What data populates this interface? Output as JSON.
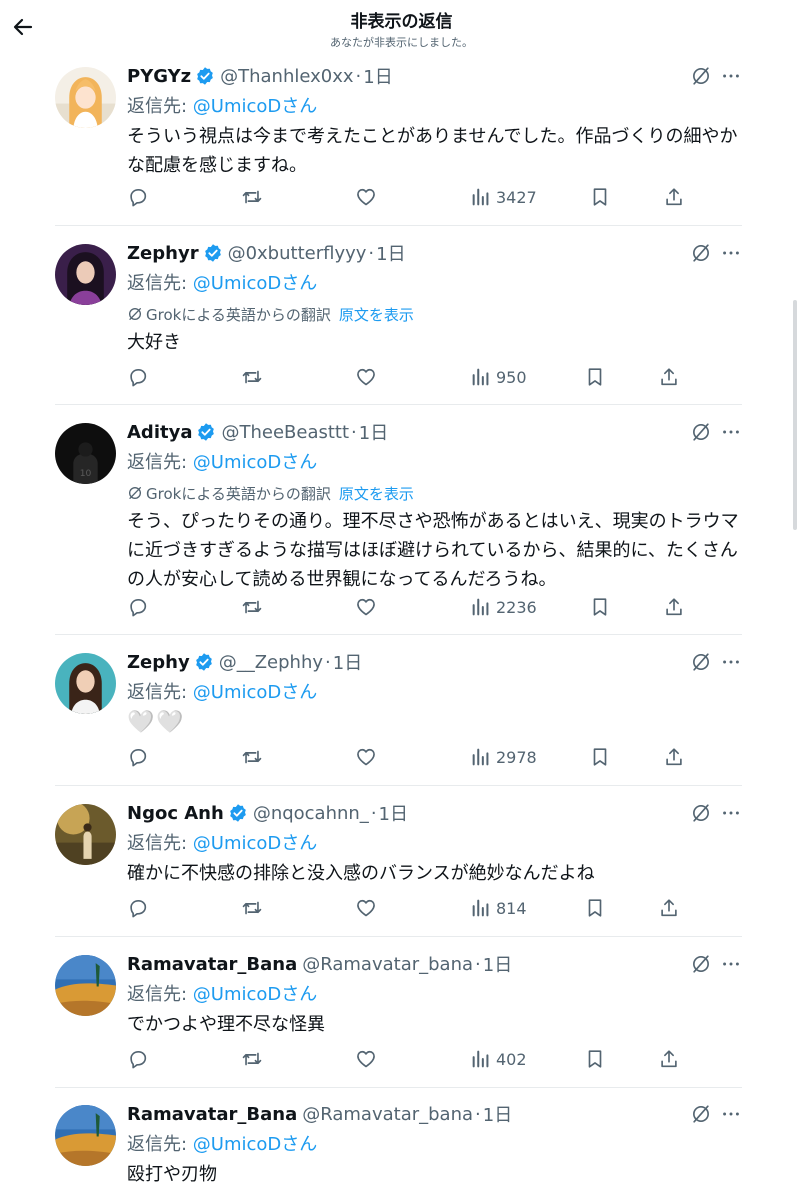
{
  "header": {
    "title": "非表示の返信",
    "subtitle": "あなたが非表示にしました。"
  },
  "translation": {
    "label": "Grokによる英語からの翻訳",
    "show_original": "原文を表示"
  },
  "tweets": [
    {
      "name": "PYGYz",
      "handle": "@Thanhlex0xx",
      "separator": "·",
      "time": "1日",
      "reply_prefix": "返信先: ",
      "reply_handle": "@UmicoDさん",
      "text": "そういう視点は今まで考えたことがありませんでした。作品づくりの細やかな配慮を感じますね。",
      "views": "3427"
    },
    {
      "name": "Zephyr",
      "handle": "@0xbutterflyyy",
      "separator": "·",
      "time": "1日",
      "reply_prefix": "返信先: ",
      "reply_handle": "@UmicoDさん",
      "text": "大好き",
      "views": "950"
    },
    {
      "name": "Aditya",
      "handle": "@TheeBeasttt",
      "separator": "·",
      "time": "1日",
      "reply_prefix": "返信先: ",
      "reply_handle": "@UmicoDさん",
      "text": "そう、ぴったりその通り。理不尽さや恐怖があるとはいえ、現実のトラウマに近づきすぎるような描写はほぼ避けられているから、結果的に、たくさんの人が安心して読める世界観になってるんだろうね。",
      "views": "2236"
    },
    {
      "name": "Zephy",
      "handle": "@__Zephhy",
      "separator": "·",
      "time": "1日",
      "reply_prefix": "返信先: ",
      "reply_handle": "@UmicoDさん",
      "text": "🤍🤍",
      "views": "2978"
    },
    {
      "name": "Ngoc Anh",
      "handle": "@nqocahnn_",
      "separator": "·",
      "time": "1日",
      "reply_prefix": "返信先: ",
      "reply_handle": "@UmicoDさん",
      "text": "確かに不快感の排除と没入感のバランスが絶妙なんだよね",
      "views": "814"
    },
    {
      "name": "Ramavatar_Bana",
      "handle": "@Ramavatar_bana",
      "separator": "·",
      "time": "1日",
      "reply_prefix": "返信先: ",
      "reply_handle": "@UmicoDさん",
      "text": "でかつよや理不尽な怪異",
      "views": "402"
    },
    {
      "name": "Ramavatar_Bana",
      "handle": "@Ramavatar_bana",
      "separator": "·",
      "time": "1日",
      "reply_prefix": "返信先: ",
      "reply_handle": "@UmicoDさん",
      "text": "殴打や刃物"
    }
  ],
  "colors": {
    "accent": "#1d9bf0",
    "secondary_text": "#536471",
    "divider": "#e8ebed"
  }
}
